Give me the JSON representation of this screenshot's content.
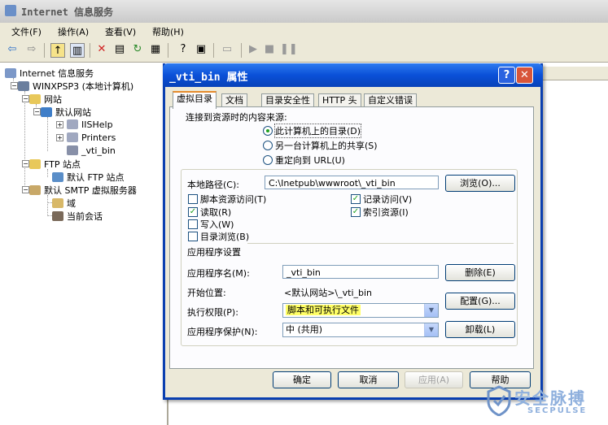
{
  "main_window": {
    "title": "Internet 信息服务",
    "menu": [
      "文件(F)",
      "操作(A)",
      "查看(V)",
      "帮助(H)"
    ]
  },
  "toolbar": {
    "icons": [
      "back-icon",
      "forward-icon",
      "up-icon",
      "show-tree-icon",
      "delete-icon",
      "properties-icon",
      "refresh-icon",
      "export-icon",
      "help-icon",
      "console-icon",
      "computer-icon",
      "start-icon",
      "stop-icon",
      "pause-icon"
    ]
  },
  "tree": {
    "root": "Internet 信息服务",
    "computer": "WINXPSP3 (本地计算机)",
    "websites": "网站",
    "default_site": "默认网站",
    "iishelp": "IISHelp",
    "printers": "Printers",
    "vti_bin": "_vti_bin",
    "ftp_sites": "FTP 站点",
    "default_ftp": "默认 FTP 站点",
    "smtp": "默认 SMTP 虚拟服务器",
    "domains": "域",
    "sessions": "当前会话"
  },
  "dialog": {
    "title": "_vti_bin 属性",
    "help_glyph": "?",
    "close_glyph": "✕",
    "tabs": [
      "虚拟目录",
      "文档",
      "目录安全性",
      "HTTP 头",
      "自定义错误"
    ],
    "source_label": "连接到资源时的内容来源:",
    "radios": [
      {
        "label": "此计算机上的目录(D)",
        "selected": true
      },
      {
        "label": "另一台计算机上的共享(S)",
        "selected": false
      },
      {
        "label": "重定向到 URL(U)",
        "selected": false
      }
    ],
    "local_path_label": "本地路径(C):",
    "local_path_value": "C:\\Inetpub\\wwwroot\\_vti_bin",
    "browse_button": "浏览(O)...",
    "checkboxes_left": [
      {
        "label": "脚本资源访问(T)",
        "checked": false
      },
      {
        "label": "读取(R)",
        "checked": true
      },
      {
        "label": "写入(W)",
        "checked": false
      },
      {
        "label": "目录浏览(B)",
        "checked": false
      }
    ],
    "checkboxes_right": [
      {
        "label": "记录访问(V)",
        "checked": true
      },
      {
        "label": "索引资源(I)",
        "checked": true
      }
    ],
    "app_settings_label": "应用程序设置",
    "app_name_label": "应用程序名(M):",
    "app_name_value": "_vti_bin",
    "remove_button": "删除(E)",
    "start_point_label": "开始位置:",
    "start_point_value": "<默认网站>\\_vti_bin",
    "config_button": "配置(G)...",
    "exec_perm_label": "执行权限(P):",
    "exec_perm_value": "脚本和可执行文件",
    "exec_perm_highlight": "#ffff66",
    "app_protect_label": "应用程序保护(N):",
    "app_protect_value": "中 (共用)",
    "unload_button": "卸载(L)",
    "ok_button": "确定",
    "cancel_button": "取消",
    "apply_button": "应用(A)",
    "help_button": "帮助"
  },
  "watermark": {
    "brand": "安全脉搏",
    "sub": "SECPULSE"
  },
  "colors": {
    "title_blue": "#0a50d8",
    "xp_face": "#ece9d8",
    "check_green": "#21a121"
  }
}
